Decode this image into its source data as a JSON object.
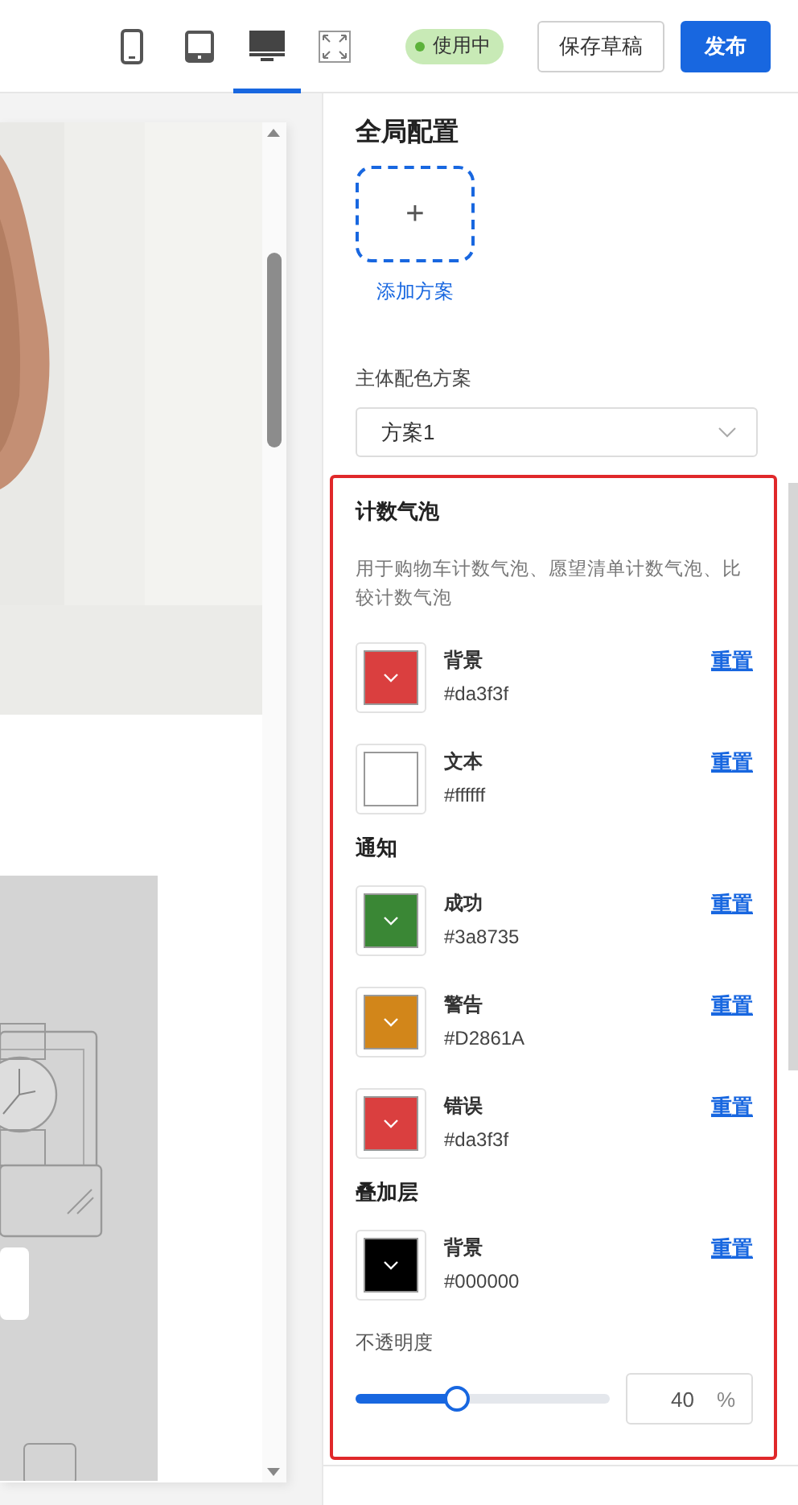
{
  "toolbar": {
    "devices": [
      {
        "kind": "phone",
        "selected": false
      },
      {
        "kind": "tablet",
        "selected": false
      },
      {
        "kind": "desktop",
        "selected": true
      },
      {
        "kind": "fullscreen",
        "selected": false
      }
    ],
    "status": {
      "label": "使用中",
      "active": true
    },
    "buttons": [
      {
        "label": "保存草稿",
        "kind": "secondary"
      },
      {
        "label": "发布",
        "kind": "primary"
      }
    ]
  },
  "panel": {
    "title": "全局配置",
    "add_label": "添加方案",
    "add_icon": "+",
    "scheme_label": "主体配色方案",
    "scheme_value": "方案1",
    "groups": [
      {
        "title": "计数气泡",
        "description": "用于购物车计数气泡、愿望清单计数气泡、比较计数气泡",
        "colors": [
          {
            "name": "背景",
            "value": "#da3f3f",
            "color": "#da3f3f",
            "reset": "重置"
          },
          {
            "name": "文本",
            "value": "#ffffff",
            "color": "#ffffff",
            "reset": "重置"
          }
        ]
      },
      {
        "title": "通知",
        "colors": [
          {
            "name": "成功",
            "value": "#3a8735",
            "color": "#3a8735",
            "reset": "重置"
          },
          {
            "name": "警告",
            "value": "#D2861A",
            "color": "#d2861a",
            "reset": "重置"
          },
          {
            "name": "错误",
            "value": "#da3f3f",
            "color": "#da3f3f",
            "reset": "重置"
          }
        ]
      },
      {
        "title": "叠加层",
        "colors": [
          {
            "name": "背景",
            "value": "#000000",
            "color": "#000000",
            "reset": "重置"
          }
        ]
      }
    ],
    "opacity": {
      "label": "不透明度",
      "level": 0.4,
      "value": "40",
      "unit": "%"
    }
  }
}
